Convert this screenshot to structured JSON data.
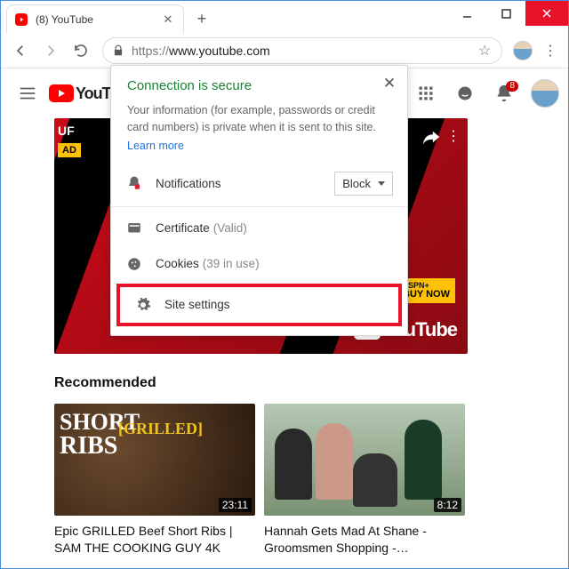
{
  "window": {
    "tab_title": "(8) YouTube",
    "url_proto": "https://",
    "url_host": "www.youtube.com"
  },
  "yt": {
    "logo_text": "YouTube",
    "wm_text": "YouTube",
    "notif_count": "8",
    "section_title": "Recommended"
  },
  "banner": {
    "uf": "UF",
    "ad": "AD",
    "espn_line1": "ESPN+",
    "espn_line2": "BUY NOW"
  },
  "popup": {
    "title": "Connection is secure",
    "desc": "Your information (for example, passwords or credit card numbers) is private when it is sent to this site.",
    "learn": "Learn more",
    "notifications_label": "Notifications",
    "notifications_value": "Block",
    "cert_label": "Certificate",
    "cert_value": "(Valid)",
    "cookies_label": "Cookies",
    "cookies_value": "(39 in use)",
    "settings_label": "Site settings"
  },
  "videos": [
    {
      "duration": "23:11",
      "title": "Epic GRILLED Beef Short Ribs | SAM THE COOKING GUY 4K",
      "ov1": "SHORT",
      "ov2": "RIBS",
      "ov3": "[GRILLED]"
    },
    {
      "duration": "8:12",
      "title": "Hannah Gets Mad At Shane - Groomsmen Shopping -…"
    }
  ]
}
